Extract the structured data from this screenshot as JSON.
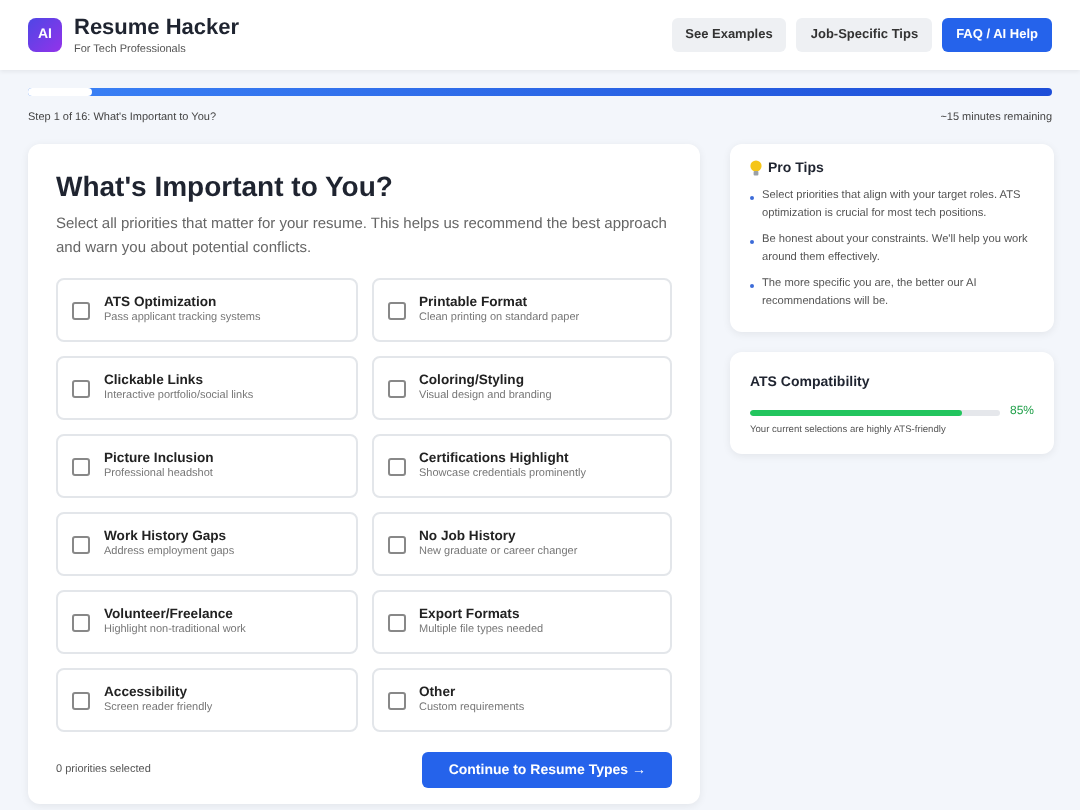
{
  "header": {
    "logo": "AI",
    "title": "Resume Hacker",
    "subtitle": "For Tech Professionals",
    "buttons": [
      {
        "label": "See Examples",
        "kind": "secondary"
      },
      {
        "label": "Job-Specific Tips",
        "kind": "secondary"
      },
      {
        "label": "FAQ / AI Help",
        "kind": "primary"
      }
    ]
  },
  "progress": {
    "level": 0.0625,
    "step": "Step 1 of 16: What's Important to You?",
    "remaining": "~15 minutes remaining"
  },
  "main": {
    "title": "What's Important to You?",
    "description": "Select all priorities that matter for your resume. This helps us recommend the best approach and warn you about potential conflicts.",
    "options": [
      {
        "title": "ATS Optimization",
        "description": "Pass applicant tracking systems",
        "checked": false
      },
      {
        "title": "Printable Format",
        "description": "Clean printing on standard paper",
        "checked": false
      },
      {
        "title": "Clickable Links",
        "description": "Interactive portfolio/social links",
        "checked": false
      },
      {
        "title": "Coloring/Styling",
        "description": "Visual design and branding",
        "checked": false
      },
      {
        "title": "Picture Inclusion",
        "description": "Professional headshot",
        "checked": false
      },
      {
        "title": "Certifications Highlight",
        "description": "Showcase credentials prominently",
        "checked": false
      },
      {
        "title": "Work History Gaps",
        "description": "Address employment gaps",
        "checked": false
      },
      {
        "title": "No Job History",
        "description": "New graduate or career changer",
        "checked": false
      },
      {
        "title": "Volunteer/Freelance",
        "description": "Highlight non-traditional work",
        "checked": false
      },
      {
        "title": "Export Formats",
        "description": "Multiple file types needed",
        "checked": false
      },
      {
        "title": "Accessibility",
        "description": "Screen reader friendly",
        "checked": false
      },
      {
        "title": "Other",
        "description": "Custom requirements",
        "checked": false
      }
    ],
    "selected_count": "0 priorities selected",
    "continue_button": "Continue to Resume Types →"
  },
  "sidebar": {
    "tips": {
      "title": "Pro Tips",
      "items": [
        "Select priorities that align with your target roles. ATS optimization is crucial for most tech positions.",
        "Be honest about your constraints. We'll help you work around them effectively.",
        "The more specific you are, the better our AI recommendations will be."
      ]
    },
    "ats": {
      "title": "ATS Compatibility",
      "level": 0.85,
      "reading": "85%",
      "note": "Your current selections are highly ATS-friendly"
    }
  }
}
